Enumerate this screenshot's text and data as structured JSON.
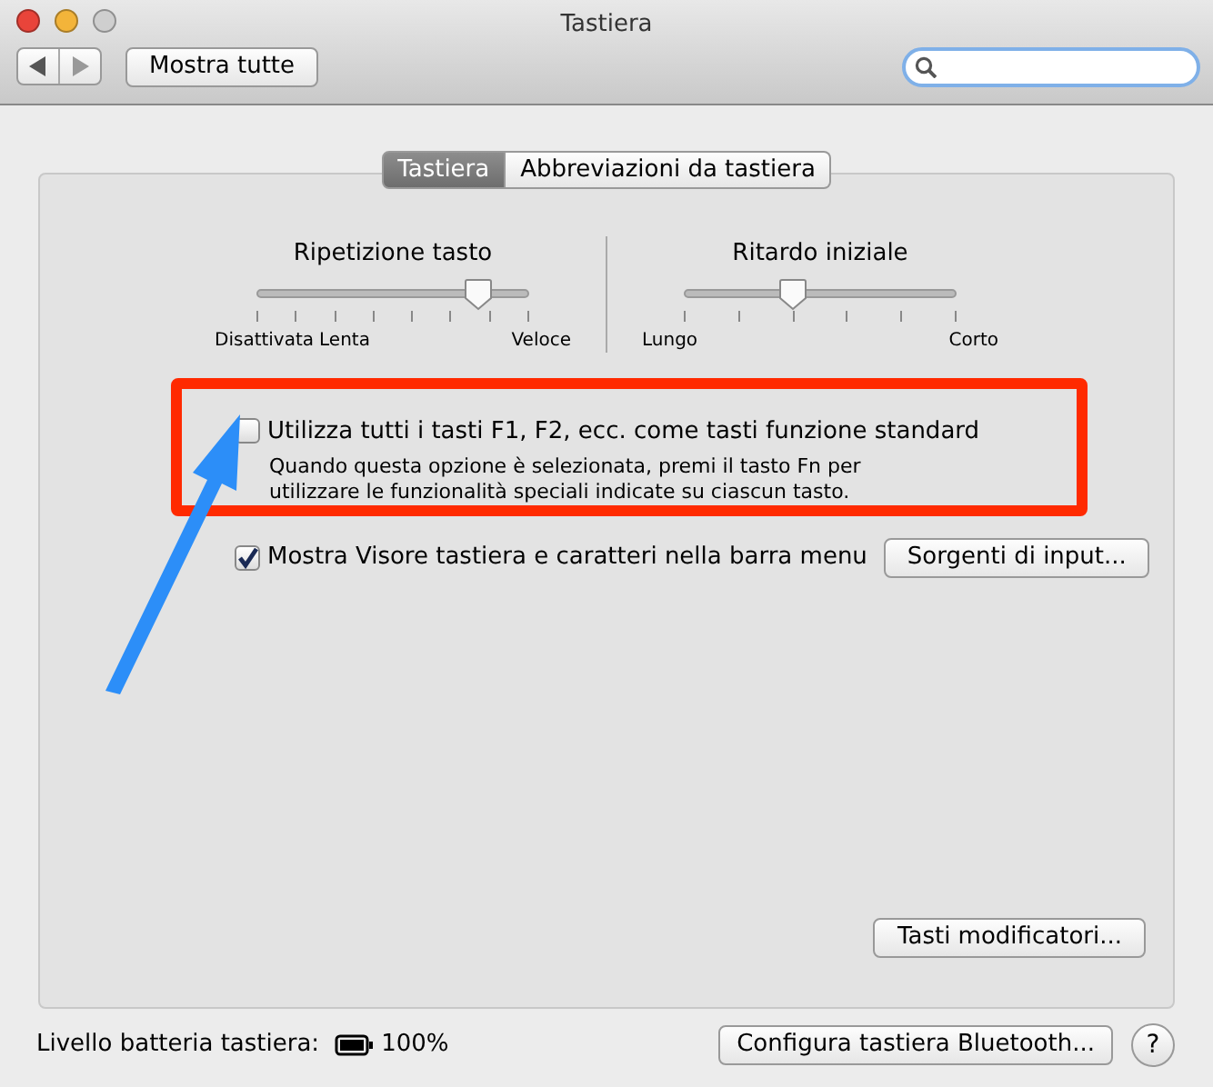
{
  "window": {
    "title": "Tastiera"
  },
  "toolbar": {
    "show_all_button": "Mostra tutte"
  },
  "tabs": [
    {
      "label": "Tastiera",
      "selected": true
    },
    {
      "label": "Abbreviazioni da tastiera",
      "selected": false
    }
  ],
  "sliders": [
    {
      "title": "Ripetizione tasto",
      "level": 0.81,
      "labels": [
        "Disattivata",
        "Lenta",
        "Veloce"
      ]
    },
    {
      "title": "Ritardo iniziale",
      "level": 0.4,
      "labels": [
        "Lungo",
        "Corto"
      ]
    }
  ],
  "options": [
    {
      "label": "Utilizza tutti i tasti F1, F2, ecc. come tasti funzione standard",
      "checked": false,
      "description": "Quando questa opzione è selezionata, premi il tasto Fn per utilizzare le funzionalità speciali indicate su ciascun tasto."
    },
    {
      "label": "Mostra Visore tastiera e caratteri nella barra menu",
      "checked": true,
      "button": "Sorgenti di input..."
    }
  ],
  "modifier_button": "Tasti modificatori...",
  "footer": {
    "battery_label": "Livello batteria tastiera:",
    "battery_value": "100%",
    "bluetooth_button": "Configura tastiera Bluetooth...",
    "help_button": "?"
  }
}
